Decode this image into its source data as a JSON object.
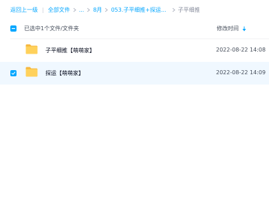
{
  "breadcrumb": {
    "back": "返回上一级",
    "all_files": "全部文件",
    "ellipsis": "...",
    "crumbs": [
      "8月",
      "053.子平细推+探运..."
    ],
    "current": "子平细推"
  },
  "list_header": {
    "selection_status": "已选中1个文件/文件夹",
    "modified_column": "修改时间",
    "sort_direction": "descending"
  },
  "files": [
    {
      "name": "子平细推【萌萌家】",
      "modified": "2022-08-22 14:08",
      "selected": false
    },
    {
      "name": "探运【萌萌家】",
      "modified": "2022-08-22 14:09",
      "selected": true
    }
  ],
  "colors": {
    "accent": "#06a7ff",
    "selected_row": "#f0f8ff",
    "folder": "#ffc53d"
  }
}
